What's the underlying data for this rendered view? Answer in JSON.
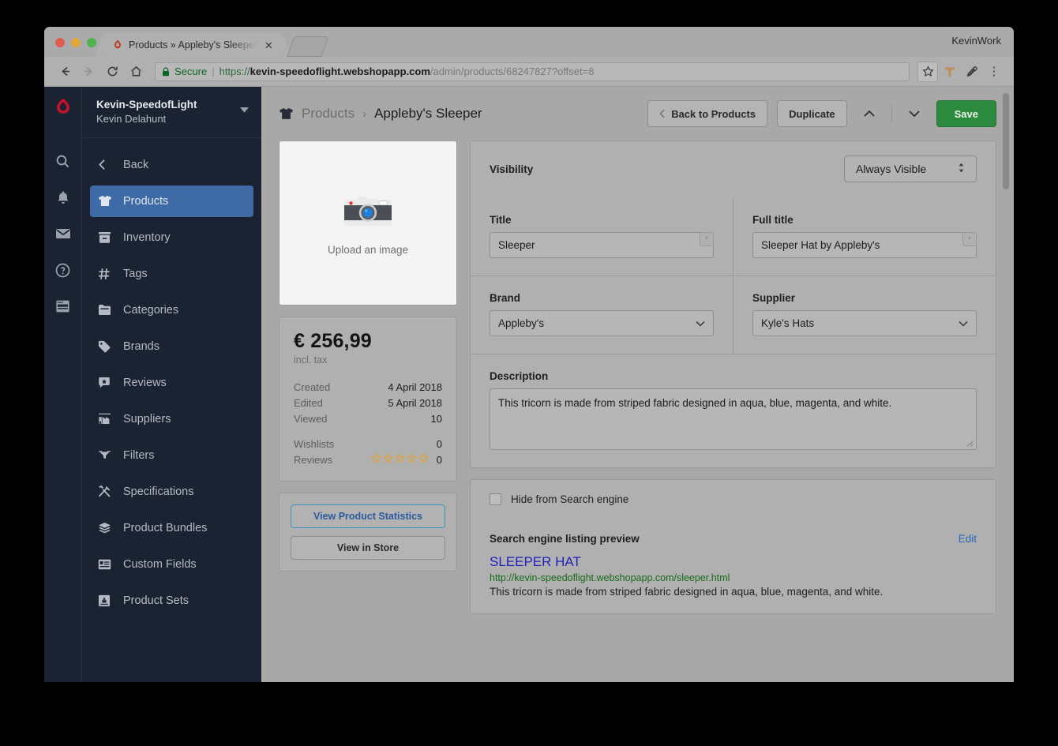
{
  "browser": {
    "tab": {
      "title": "Products » Appleby's Sleeper",
      "close_label": "✕",
      "favicon": "lightspeed-flame-icon"
    },
    "window_user": "KevinWork",
    "omnibox": {
      "secure_label": "Secure",
      "separator": "|",
      "scheme": "https://",
      "host": "kevin-speedoflight.webshopapp.com",
      "path": "/admin/products/68247827?offset=8"
    },
    "nav": {
      "back": "←",
      "forward": "→",
      "reload": "⟳",
      "home": "⌂"
    },
    "actions": {
      "bookmark": "star-icon",
      "extension1": "extension-icon",
      "extension2": "eyedropper-icon",
      "menu": "⋮"
    }
  },
  "sidebar": {
    "shop": {
      "name": "Kevin-SpeedofLight",
      "user": "Kevin Delahunt"
    },
    "rail_icons": [
      "search-icon",
      "bell-icon",
      "mail-icon",
      "help-icon",
      "browser-icon"
    ],
    "back_label": "Back",
    "items": [
      {
        "label": "Products",
        "icon": "tshirt-icon",
        "active": true
      },
      {
        "label": "Inventory",
        "icon": "inventory-icon",
        "active": false
      },
      {
        "label": "Tags",
        "icon": "hash-icon",
        "active": false
      },
      {
        "label": "Categories",
        "icon": "folder-icon",
        "active": false
      },
      {
        "label": "Brands",
        "icon": "tag-icon",
        "active": false
      },
      {
        "label": "Reviews",
        "icon": "review-icon",
        "active": false
      },
      {
        "label": "Suppliers",
        "icon": "factory-icon",
        "active": false
      },
      {
        "label": "Filters",
        "icon": "filter-icon",
        "active": false
      },
      {
        "label": "Specifications",
        "icon": "tools-icon",
        "active": false
      },
      {
        "label": "Product Bundles",
        "icon": "layers-icon",
        "active": false
      },
      {
        "label": "Custom Fields",
        "icon": "custom-fields-icon",
        "active": false
      },
      {
        "label": "Product Sets",
        "icon": "product-sets-icon",
        "active": false
      }
    ]
  },
  "topbar": {
    "breadcrumb_icon": "tshirt-icon",
    "breadcrumb_parent": "Products",
    "breadcrumb_separator": "›",
    "breadcrumb_current": "Appleby's Sleeper",
    "back_to_products": "Back to Products",
    "duplicate": "Duplicate",
    "prev_icon": "chevron-up-icon",
    "next_icon": "chevron-down-icon",
    "save": "Save"
  },
  "left": {
    "image": {
      "placeholder": "Upload an image",
      "icon": "camera-icon"
    },
    "price": {
      "amount": "€ 256,99",
      "note": "incl. tax"
    },
    "stats": [
      {
        "key": "Created",
        "value": "4 April 2018"
      },
      {
        "key": "Edited",
        "value": "5 April 2018"
      },
      {
        "key": "Viewed",
        "value": "10"
      }
    ],
    "stats2": [
      {
        "key": "Wishlists",
        "value": "0"
      },
      {
        "key": "Reviews",
        "value": "0",
        "stars": 0,
        "star_total": 5
      }
    ],
    "actions": {
      "statistics": "View Product Statistics",
      "view_store": "View in Store"
    }
  },
  "form": {
    "visibility": {
      "label": "Visibility",
      "value": "Always Visible"
    },
    "title": {
      "label": "Title",
      "value": "Sleeper",
      "badge": "*"
    },
    "full_title": {
      "label": "Full title",
      "value": "Sleeper Hat by Appleby's",
      "badge": "*"
    },
    "brand": {
      "label": "Brand",
      "value": "Appleby's"
    },
    "supplier": {
      "label": "Supplier",
      "value": "Kyle's Hats"
    },
    "description": {
      "label": "Description",
      "value": "This tricorn is made from striped fabric designed in aqua, blue, magenta, and white."
    }
  },
  "seo": {
    "hide_label": "Hide from Search engine",
    "hide_checked": false,
    "preview_label": "Search engine listing preview",
    "edit_label": "Edit",
    "result_title": "SLEEPER HAT",
    "result_url": "http://kevin-speedoflight.webshopapp.com/sleeper.html",
    "result_desc": "This tricorn is made from striped fabric designed in aqua, blue, magenta, and white."
  },
  "colors": {
    "sidebar_bg": "#1b2231",
    "active_nav": "#3e6ba5",
    "save_green": "#2b8a3e",
    "link_blue": "#2a68b8",
    "seo_title_blue": "#2222bb",
    "seo_url_green": "#176b18",
    "star_orange": "#e0a23c",
    "secure_green": "#0b6623"
  }
}
